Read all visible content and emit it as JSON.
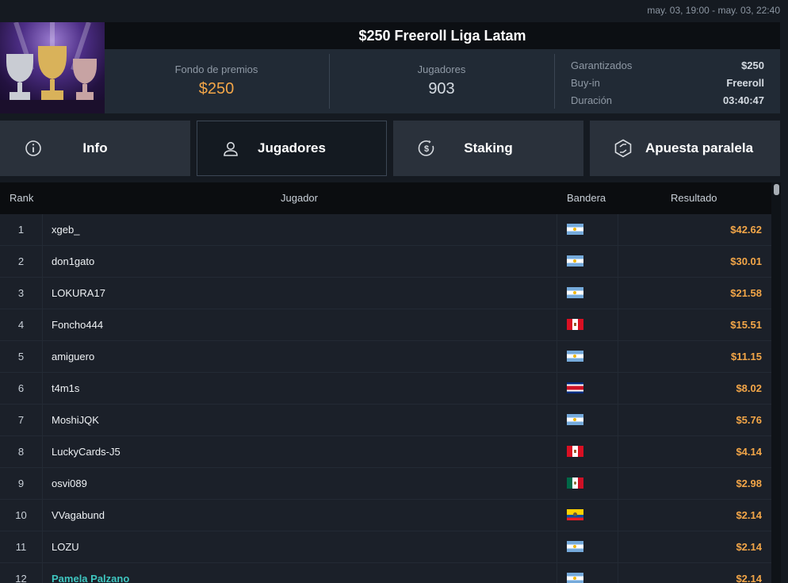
{
  "dates": "may. 03, 19:00 - may. 03, 22:40",
  "tournament": {
    "title": "$250 Freeroll Liga Latam",
    "prize_label": "Fondo de premios",
    "prize_value": "$250",
    "players_label": "Jugadores",
    "players_value": "903",
    "details": [
      {
        "key": "Garantizados",
        "value": "$250"
      },
      {
        "key": "Buy-in",
        "value": "Freeroll"
      },
      {
        "key": "Duración",
        "value": "03:40:47"
      }
    ]
  },
  "tabs": [
    {
      "label": "Info",
      "icon": "info-icon"
    },
    {
      "label": "Jugadores",
      "icon": "user-icon",
      "active": true
    },
    {
      "label": "Staking",
      "icon": "dollar-coin-icon"
    },
    {
      "label": "Apuesta paralela",
      "icon": "side-bet-icon"
    }
  ],
  "table": {
    "headers": {
      "rank": "Rank",
      "player": "Jugador",
      "flag": "Bandera",
      "result": "Resultado"
    },
    "rows": [
      {
        "rank": "1",
        "name": "xgeb_",
        "flag": "ar",
        "result": "$42.62"
      },
      {
        "rank": "2",
        "name": "don1gato",
        "flag": "ar",
        "result": "$30.01"
      },
      {
        "rank": "3",
        "name": "LOKURA17",
        "flag": "ar",
        "result": "$21.58"
      },
      {
        "rank": "4",
        "name": "Foncho444",
        "flag": "pe",
        "result": "$15.51"
      },
      {
        "rank": "5",
        "name": "amiguero",
        "flag": "ar",
        "result": "$11.15"
      },
      {
        "rank": "6",
        "name": "t4m1s",
        "flag": "cr",
        "result": "$8.02"
      },
      {
        "rank": "7",
        "name": "MoshiJQK",
        "flag": "ar",
        "result": "$5.76"
      },
      {
        "rank": "8",
        "name": "LuckyCards-J5",
        "flag": "pe",
        "result": "$4.14"
      },
      {
        "rank": "9",
        "name": "osvi089",
        "flag": "mx",
        "result": "$2.98"
      },
      {
        "rank": "10",
        "name": "VVagabund",
        "flag": "ec",
        "result": "$2.14"
      },
      {
        "rank": "11",
        "name": "LOZU",
        "flag": "ar",
        "result": "$2.14"
      },
      {
        "rank": "12",
        "name": "Pamela Palzano",
        "flag": "ar",
        "result": "$2.14",
        "highlight": true
      }
    ]
  }
}
